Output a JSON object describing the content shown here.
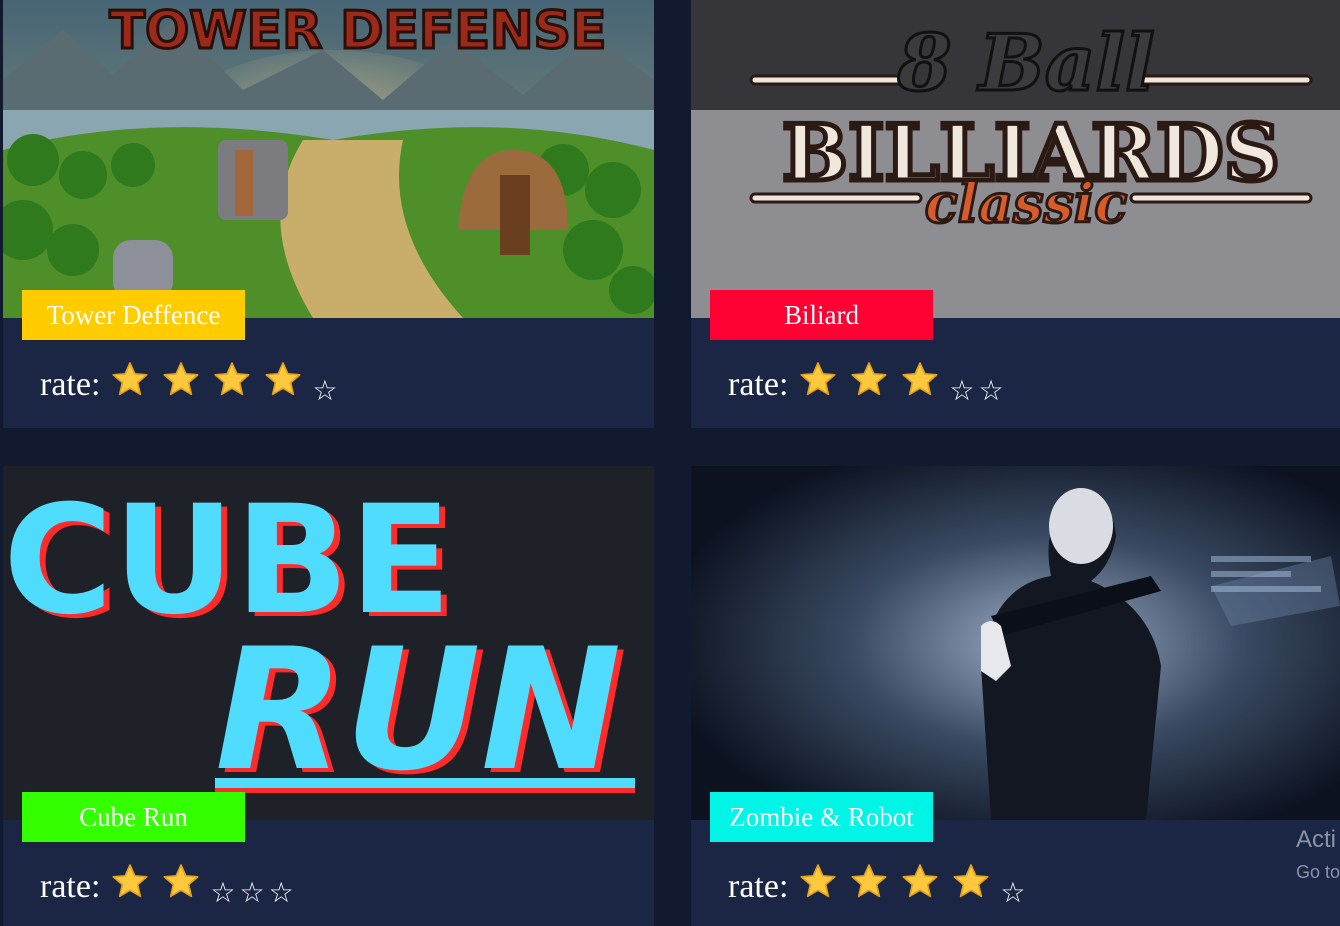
{
  "rate_label": "rate:",
  "games": [
    {
      "title": "Tower Deffence",
      "tag_color": "#ffcc00",
      "rating": 4,
      "max_rating": 5,
      "art_text": "TOWER DEFENSE"
    },
    {
      "title": "Biliard",
      "tag_color": "#ff0033",
      "rating": 3,
      "max_rating": 5,
      "art_text": [
        "8 Ball",
        "BILLIARDS",
        "classic"
      ]
    },
    {
      "title": "Cube Run",
      "tag_color": "#33ff00",
      "rating": 2,
      "max_rating": 5,
      "art_text": [
        "CUBE",
        "RUN"
      ]
    },
    {
      "title": "Zombie & Robot",
      "tag_color": "#00f5e6",
      "rating": 4,
      "max_rating": 5
    }
  ],
  "watermark": {
    "line1": "Acti",
    "line2": "Go to"
  }
}
